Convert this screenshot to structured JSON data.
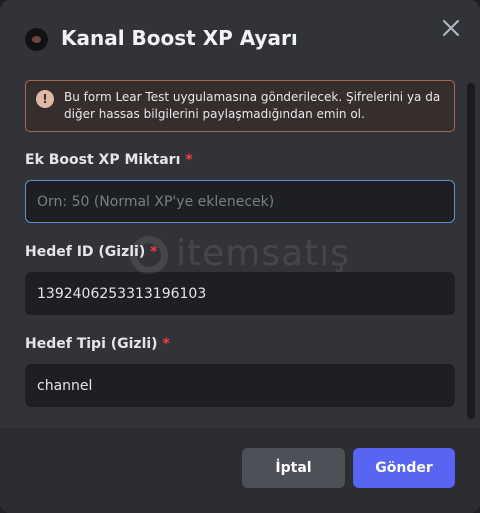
{
  "modal": {
    "title": "Kanal Boost XP Ayarı",
    "close_icon": "close-icon"
  },
  "notice": {
    "icon": "warning-exclamation-icon",
    "text": "Bu form Lear Test uygulamasına gönderilecek. Şifrelerini ya da diğer hassas bilgilerini paylaşmadığından emin ol."
  },
  "fields": [
    {
      "label": "Ek Boost XP Miktarı",
      "required_mark": "*",
      "value": "",
      "placeholder": "Örn: 50 (Normal XP'ye eklenecek)"
    },
    {
      "label": "Hedef ID (Gizli)",
      "required_mark": "*",
      "value": "1392406253313196103"
    },
    {
      "label": "Hedef Tipi (Gizli)",
      "required_mark": "*",
      "value": "channel"
    }
  ],
  "watermark": {
    "text": "itemsatış"
  },
  "footer": {
    "cancel_label": "İptal",
    "submit_label": "Gönder"
  },
  "colors": {
    "accent": "#5865f2",
    "required": "#f23f43",
    "notice_border": "#a36a4d",
    "focus_border": "#5b8fd1"
  }
}
